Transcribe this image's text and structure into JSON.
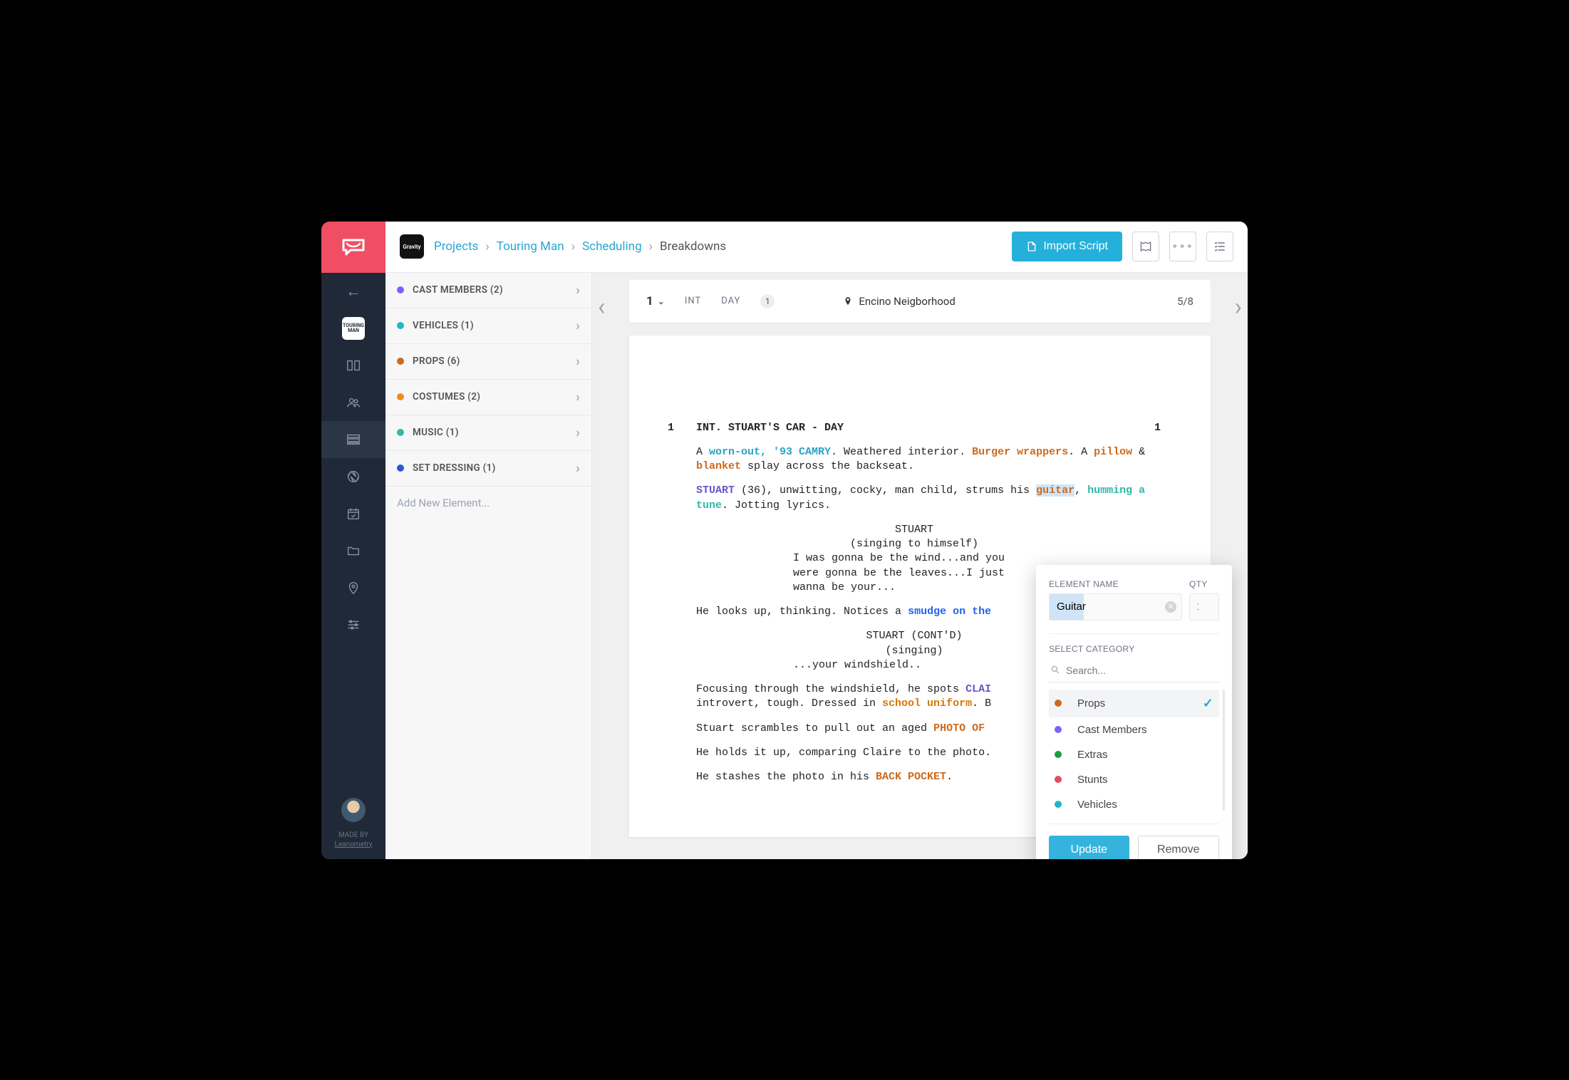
{
  "breadcrumb": {
    "projects": "Projects",
    "project": "Touring Man",
    "section": "Scheduling",
    "current": "Breakdowns"
  },
  "topbar": {
    "import": "Import Script",
    "project_badge": "Gravity"
  },
  "sidebar": {
    "categories": [
      {
        "label": "CAST MEMBERS (2)",
        "color": "#7b61ff"
      },
      {
        "label": "VEHICLES (1)",
        "color": "#1fb6c9"
      },
      {
        "label": "PROPS (6)",
        "color": "#cd6a1e"
      },
      {
        "label": "COSTUMES (2)",
        "color": "#f08c1a"
      },
      {
        "label": "MUSIC (1)",
        "color": "#2fb8aa"
      },
      {
        "label": "SET DRESSING (1)",
        "color": "#2958d6"
      }
    ],
    "add_placeholder": "Add New Element..."
  },
  "scene_header": {
    "number": "1",
    "ie": "INT",
    "time": "DAY",
    "count": "1",
    "location": "Encino Neigborhood",
    "page": "5/8"
  },
  "script": {
    "scene_num_left": "1",
    "slug": "INT. STUART'S CAR - DAY",
    "scene_num_right": "1",
    "a1_pre": "A ",
    "a1_vehicle": "worn-out, '93 CAMRY",
    "a1_mid": ". Weathered interior. ",
    "a1_prop1": "Burger wrappers",
    "a1_mid2": ". A ",
    "a1_prop2": "pillow",
    "a1_amp": " & ",
    "a1_prop3": "blanket",
    "a1_post": " splay across the backseat.",
    "a2_cast": "STUART",
    "a2_mid": " (36), unwitting, cocky, man child, strums his ",
    "a2_prop": "guitar",
    "a2_mid2": ", ",
    "a2_music": "humming a tune",
    "a2_post": ". Jotting lyrics.",
    "char1": "STUART",
    "paren1": "(singing to himself)",
    "dlg1": "I was gonna be the wind...and you were gonna be the leaves...I just wanna be your...",
    "a3_pre": "He looks up, thinking. Notices a ",
    "a3_setdress": "smudge on the ",
    "char2": "STUART (CONT'D)",
    "paren2": "(singing)",
    "dlg2": "...your windshield..",
    "a4_pre": "Focusing through the windshield, he spots ",
    "a4_cast": "CLAI",
    "a4_line2_pre": "introvert, tough. Dressed in ",
    "a4_costume": "school uniform",
    "a4_line2_post": ". B",
    "a5_pre": "Stuart scrambles to pull out an aged ",
    "a5_prop": "PHOTO OF ",
    "a6": "He holds it up, comparing Claire to the photo.",
    "a7_pre": "He stashes the photo in his ",
    "a7_prop": "BACK POCKET",
    "a7_post": "."
  },
  "popover": {
    "label_name": "ELEMENT NAME",
    "label_qty": "QTY",
    "name_value": "Guitar",
    "qty_value": "1",
    "label_select": "SELECT CATEGORY",
    "search_placeholder": "Search...",
    "categories": [
      {
        "label": "Props",
        "color": "#cd6a1e",
        "selected": true
      },
      {
        "label": "Cast Members",
        "color": "#7b61ff",
        "selected": false
      },
      {
        "label": "Extras",
        "color": "#1a9e3e",
        "selected": false
      },
      {
        "label": "Stunts",
        "color": "#e74a5e",
        "selected": false
      },
      {
        "label": "Vehicles",
        "color": "#1fb6c9",
        "selected": false
      }
    ],
    "update": "Update",
    "remove": "Remove"
  },
  "footer": {
    "made_by": "MADE BY",
    "author": "Leanometry"
  }
}
